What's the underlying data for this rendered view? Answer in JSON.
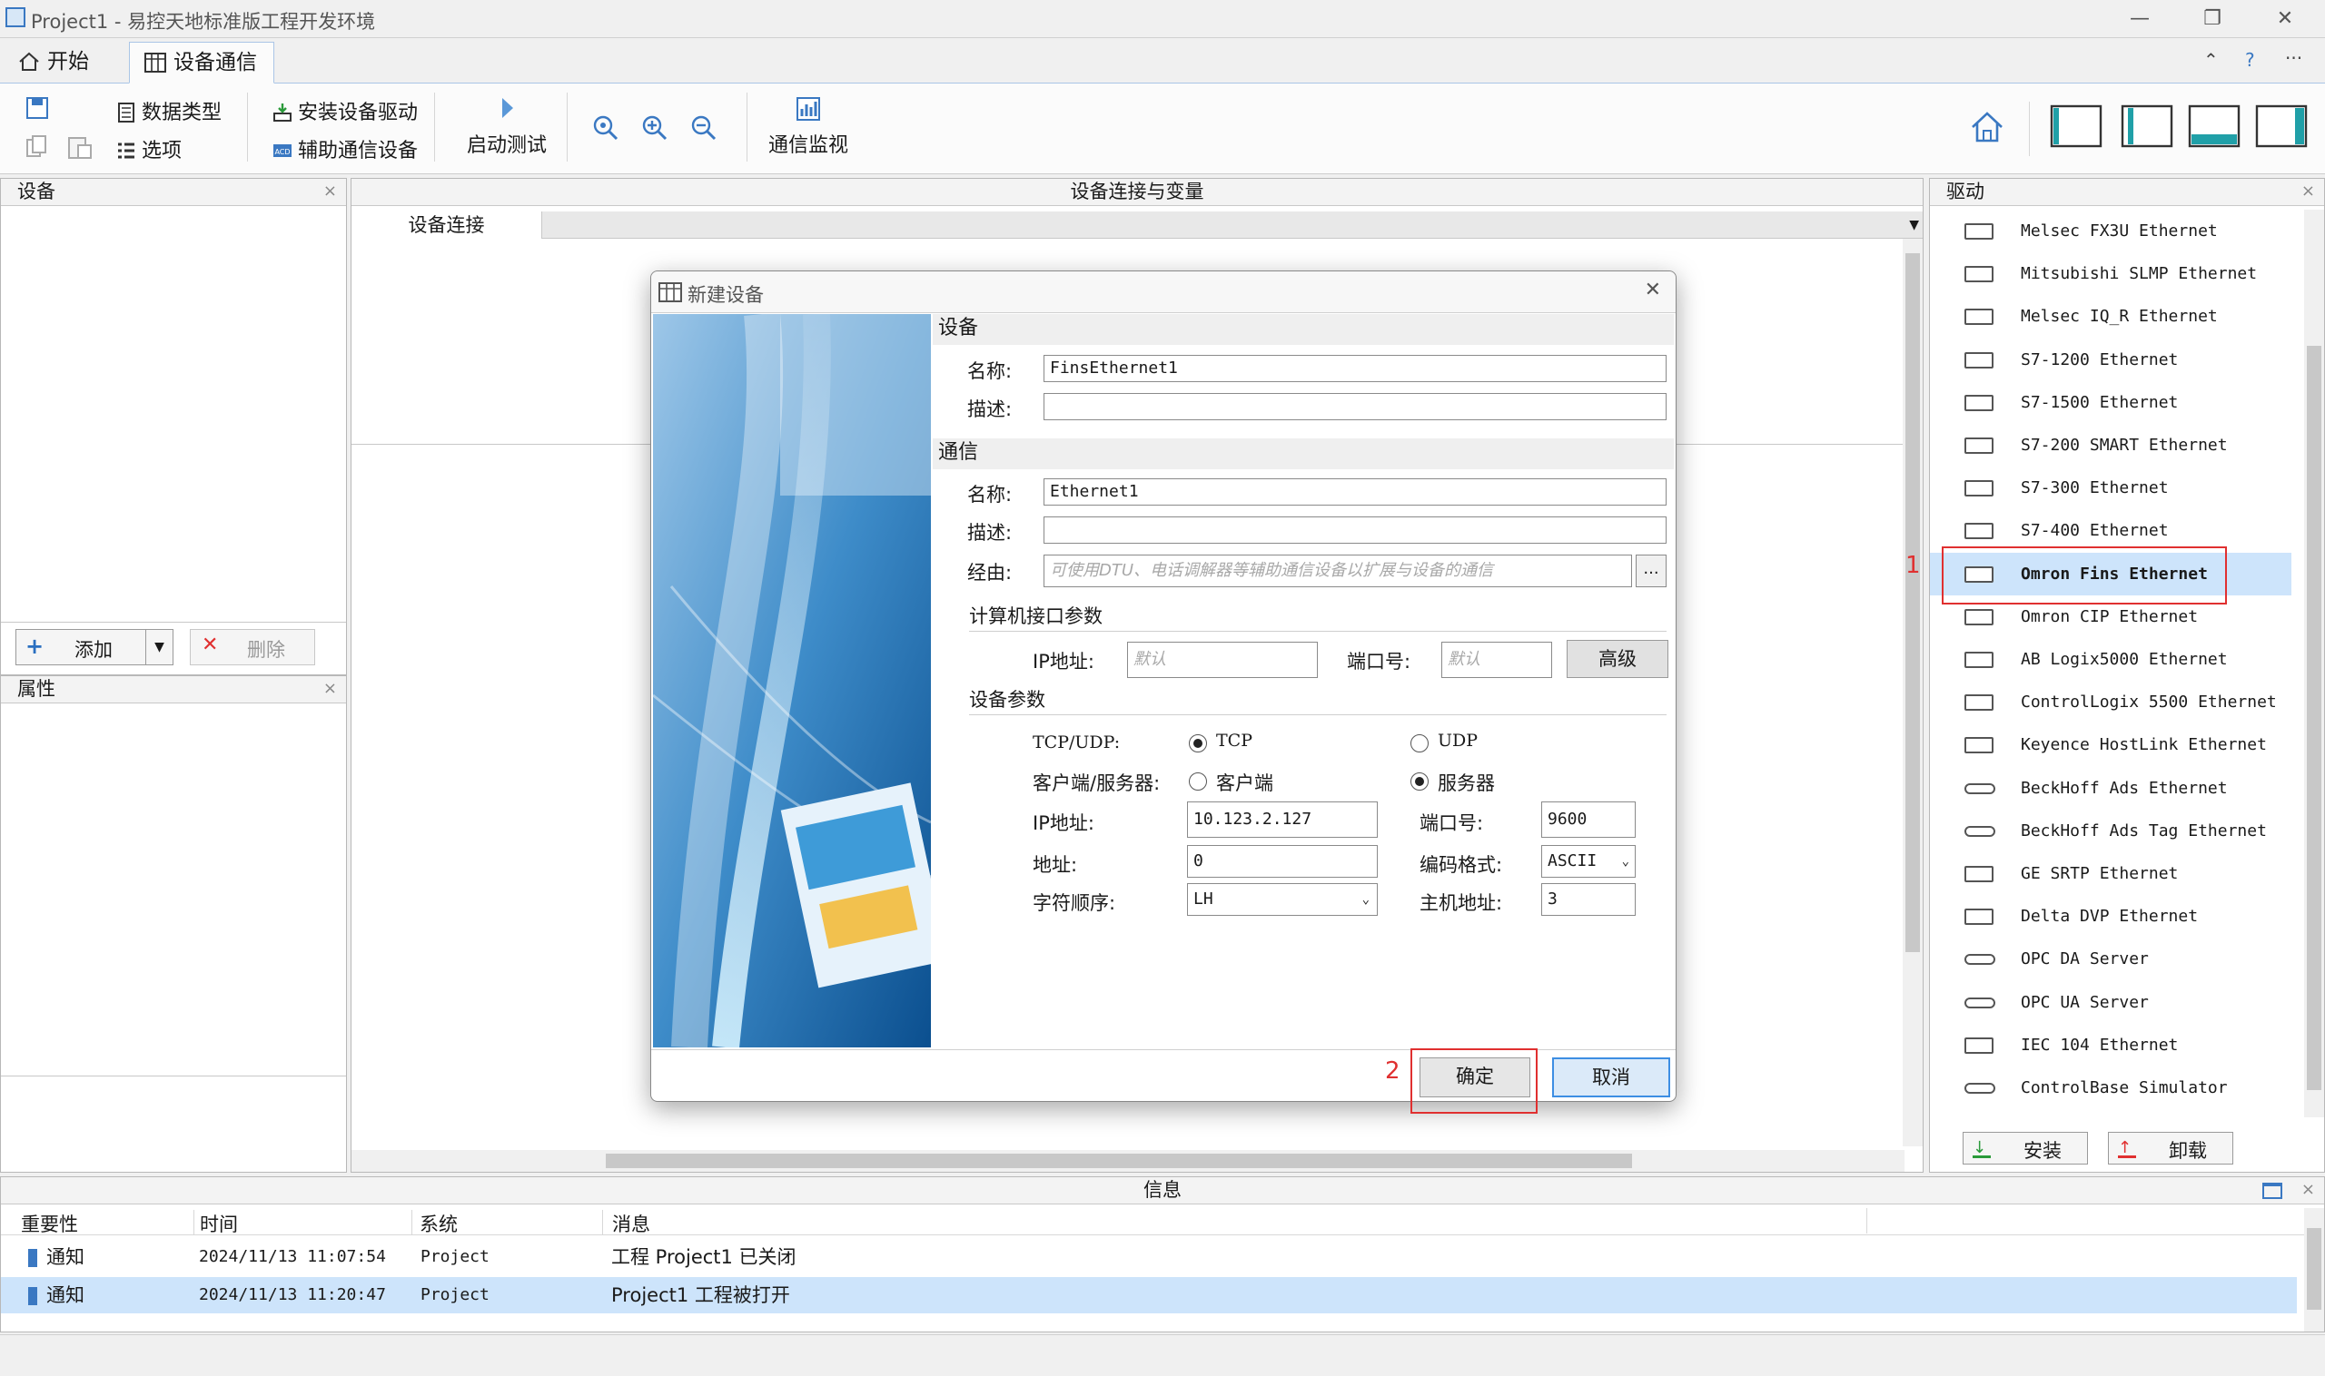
{
  "window": {
    "title": "Project1 - 易控天地标准版工程开发环境",
    "minimize": "—",
    "restore": "❐",
    "close": "✕"
  },
  "tabs": [
    {
      "label": "开始",
      "icon": "home-icon"
    },
    {
      "label": "设备通信",
      "icon": "table-icon"
    }
  ],
  "tabbar_right": {
    "up": "⌃",
    "help": "?",
    "more": "···"
  },
  "ribbon": {
    "data_type": "数据类型",
    "options": "选项",
    "install_driver": "安装设备驱动",
    "aux_device": "辅助通信设备",
    "start_test": "启动测试",
    "comm_monitor": "通信监视"
  },
  "device_panel": {
    "title": "设备",
    "add": "添加",
    "delete": "删除",
    "close": "×"
  },
  "property_panel": {
    "title": "属性",
    "close": "×"
  },
  "center": {
    "title": "设备连接与变量",
    "tab": "设备连接"
  },
  "driver_panel": {
    "title": "驱动",
    "close": "×",
    "install": "安装",
    "uninstall": "卸载",
    "items": [
      {
        "name": "Melsec FX3U Ethernet",
        "icon": "ethernet-port-icon"
      },
      {
        "name": "Mitsubishi SLMP Ethernet",
        "icon": "ethernet-port-icon"
      },
      {
        "name": "Melsec IQ_R Ethernet",
        "icon": "ethernet-port-icon"
      },
      {
        "name": "S7-1200 Ethernet",
        "icon": "ethernet-port-icon"
      },
      {
        "name": "S7-1500 Ethernet",
        "icon": "ethernet-port-icon"
      },
      {
        "name": "S7-200 SMART Ethernet",
        "icon": "ethernet-port-icon"
      },
      {
        "name": "S7-300 Ethernet",
        "icon": "ethernet-port-icon"
      },
      {
        "name": "S7-400 Ethernet",
        "icon": "ethernet-port-icon"
      },
      {
        "name": "Omron Fins Ethernet",
        "icon": "ethernet-port-icon",
        "selected": true
      },
      {
        "name": "Omron CIP Ethernet",
        "icon": "ethernet-port-icon"
      },
      {
        "name": "AB Logix5000 Ethernet",
        "icon": "ethernet-port-icon"
      },
      {
        "name": "ControlLogix 5500 Ethernet",
        "icon": "ethernet-port-icon"
      },
      {
        "name": "Keyence HostLink Ethernet",
        "icon": "ethernet-port-icon"
      },
      {
        "name": "BeckHoff Ads Ethernet",
        "icon": "link-icon"
      },
      {
        "name": "BeckHoff Ads Tag Ethernet",
        "icon": "link-icon"
      },
      {
        "name": "GE SRTP Ethernet",
        "icon": "ethernet-port-icon"
      },
      {
        "name": "Delta DVP Ethernet",
        "icon": "ethernet-port-icon"
      },
      {
        "name": "OPC DA Server",
        "icon": "link-icon"
      },
      {
        "name": "OPC UA Server",
        "icon": "link-icon"
      },
      {
        "name": "IEC 104 Ethernet",
        "icon": "ethernet-port-icon"
      },
      {
        "name": "ControlBase Simulator",
        "icon": "link-icon"
      }
    ]
  },
  "annotations": {
    "step1": "1",
    "step2": "2"
  },
  "dialog": {
    "title": "新建设备",
    "close": "✕",
    "device_section": "设备",
    "device_name_label": "名称:",
    "device_name": "FinsEthernet1",
    "device_desc_label": "描述:",
    "device_desc": "",
    "comm_section": "通信",
    "comm_name_label": "名称:",
    "comm_name": "Ethernet1",
    "comm_desc_label": "描述:",
    "comm_desc": "",
    "route_label": "经由:",
    "route_placeholder": "可使用DTU、电话调解器等辅助通信设备以扩展与设备的通信",
    "route_button": "...",
    "pc_iface_section": "计算机接口参数",
    "pc_ip_label": "IP地址:",
    "pc_ip_placeholder": "默认",
    "pc_port_label": "端口号:",
    "pc_port_placeholder": "默认",
    "advanced": "高级",
    "device_params_section": "设备参数",
    "proto_label": "TCP/UDP:",
    "proto_tcp": "TCP",
    "proto_udp": "UDP",
    "proto_selected": "TCP",
    "role_label": "客户端/服务器:",
    "role_client": "客户端",
    "role_server": "服务器",
    "role_selected": "服务器",
    "ip_label": "IP地址:",
    "ip": "10.123.2.127",
    "port_label": "端口号:",
    "port": "9600",
    "addr_label": "地址:",
    "addr": "0",
    "encoding_label": "编码格式:",
    "encoding": "ASCII",
    "byte_order_label": "字符顺序:",
    "byte_order": "LH",
    "host_addr_label": "主机地址:",
    "host_addr": "3",
    "ok": "确定",
    "cancel": "取消"
  },
  "info_panel": {
    "title": "信息",
    "columns": [
      "重要性",
      "时间",
      "系统",
      "消息"
    ],
    "rows": [
      {
        "level": "通知",
        "time": "2024/11/13 11:07:54",
        "system": "Project",
        "message": "工程 Project1 已关闭"
      },
      {
        "level": "通知",
        "time": "2024/11/13 11:20:47",
        "system": "Project",
        "message": "Project1 工程被打开",
        "selected": true
      }
    ]
  },
  "colors": {
    "accent": "#3a78c2",
    "selection": "#cde4fb",
    "annotation": "#e03030"
  }
}
